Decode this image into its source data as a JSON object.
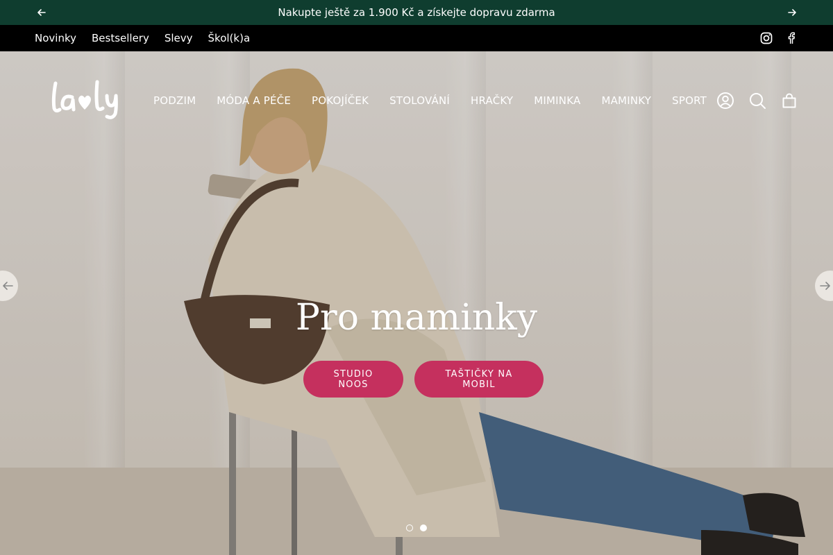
{
  "announcement": {
    "text": "Nakupte ještě za 1.900 Kč a získejte dopravu zdarma",
    "prev_icon": "arrow-left-icon",
    "next_icon": "arrow-right-icon"
  },
  "utility_links": [
    "Novinky",
    "Bestsellery",
    "Slevy",
    "Škol(k)a"
  ],
  "social": [
    {
      "name": "Instagram",
      "icon": "instagram-icon"
    },
    {
      "name": "Facebook",
      "icon": "facebook-icon"
    }
  ],
  "brand": {
    "logo_text": "lavly"
  },
  "main_menu": [
    "PODZIM",
    "MÓDA A PÉČE",
    "POKOJÍČEK",
    "STOLOVÁNÍ",
    "HRAČKY",
    "MIMINKA",
    "MAMINKY",
    "SPORT"
  ],
  "header_icons": [
    "account-icon",
    "search-icon",
    "cart-icon"
  ],
  "hero": {
    "title": "Pro maminky",
    "buttons": [
      "STUDIO NOOS",
      "TAŠTIČKY NA MOBIL"
    ],
    "slide_count": 2,
    "active_slide": 2
  },
  "colors": {
    "announcement_bg": "#0f3d2f",
    "utility_bg": "#000000",
    "cta_bg": "#c5305e"
  }
}
